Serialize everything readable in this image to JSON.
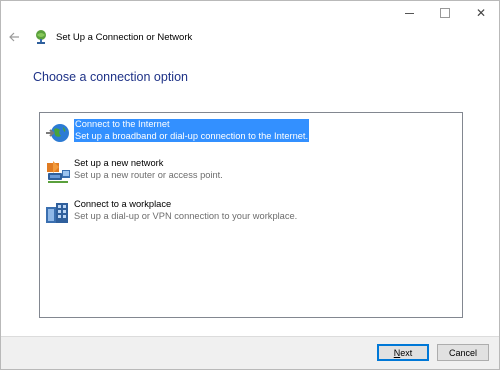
{
  "window": {
    "title": "Set Up a Connection or Network",
    "icons": {
      "app": "network-setup-icon",
      "back": "back-arrow-icon",
      "minimize": "minimize-icon",
      "maximize": "maximize-icon",
      "close": "close-icon"
    },
    "caption": {
      "close_glyph": "✕"
    }
  },
  "page": {
    "heading": "Choose a connection option"
  },
  "options": [
    {
      "title": "Connect to the Internet",
      "description": "Set up a broadband or dial-up connection to the Internet.",
      "icon": "globe-icon",
      "selected": true
    },
    {
      "title": "Set up a new network",
      "description": "Set up a new router or access point.",
      "icon": "router-icon",
      "selected": false
    },
    {
      "title": "Connect to a workplace",
      "description": "Set up a dial-up or VPN connection to your workplace.",
      "icon": "workplace-icon",
      "selected": false
    }
  ],
  "buttons": {
    "next_access_key": "N",
    "next_rest": "ext",
    "cancel": "Cancel"
  },
  "colors": {
    "heading": "#1e3287",
    "selection": "#3390ff",
    "footer": "#f0f0f0"
  }
}
